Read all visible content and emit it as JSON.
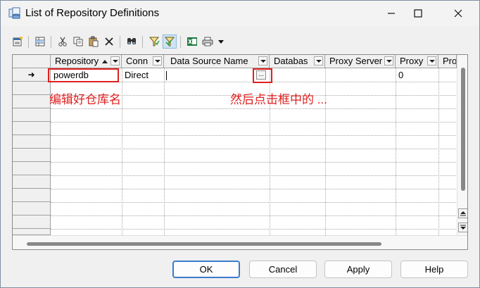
{
  "window": {
    "title": "List of Repository Definitions"
  },
  "toolbar": {
    "icons": [
      "properties-icon",
      "insert-row-icon",
      "cut-icon",
      "copy-icon",
      "paste-icon",
      "delete-icon",
      "find-icon",
      "filter-icon",
      "filter-active-icon",
      "excel-export-icon",
      "print-icon",
      "dropdown-arrow-icon"
    ]
  },
  "grid": {
    "columns": [
      {
        "label": "Repository"
      },
      {
        "label": "Conn"
      },
      {
        "label": "Data Source Name"
      },
      {
        "label": "Databas"
      },
      {
        "label": "Proxy Server"
      },
      {
        "label": "Proxy"
      },
      {
        "label": "Pro"
      }
    ],
    "row1": {
      "indicator": "➜",
      "repository": "powerdb",
      "conn": "Direct",
      "data_source_name": "",
      "ellipsis": "...",
      "proxy": "0"
    }
  },
  "annotations": {
    "edit_name": "编辑好仓库名",
    "click_ellipsis": "然后点击框中的 ..."
  },
  "buttons": {
    "ok": "OK",
    "cancel": "Cancel",
    "apply": "Apply",
    "help": "Help"
  },
  "colors": {
    "annotation": "#e02020",
    "default_button_border": "#3a7bd0"
  }
}
